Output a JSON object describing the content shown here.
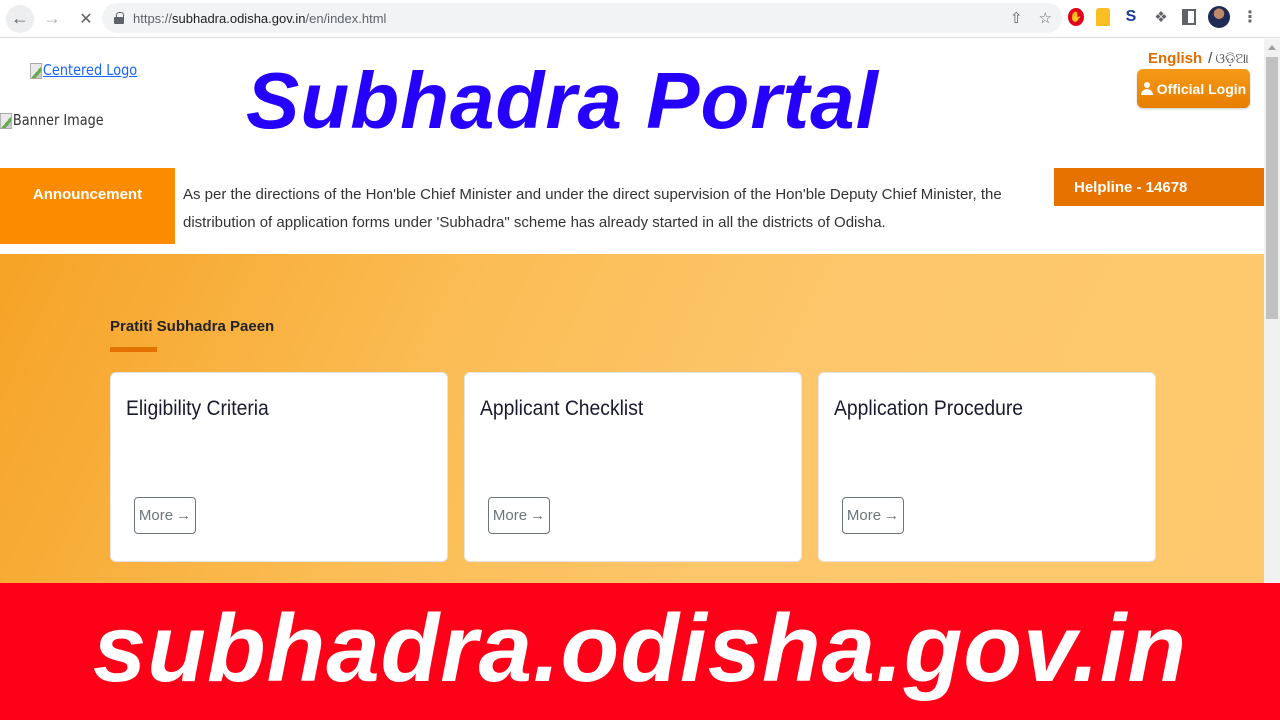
{
  "browser": {
    "url_scheme": "https://",
    "url_host": "subhadra.odisha.gov.in",
    "url_path": "/en/index.html",
    "icons": {
      "back": "back-arrow-icon",
      "forward": "forward-arrow-icon",
      "stop": "stop-loading-icon",
      "lock": "lock-icon",
      "share": "share-icon",
      "bookmark": "star-icon",
      "extensions": [
        "opera-adblock-icon",
        "amber-extension-icon",
        "swirl-extension-icon",
        "puzzle-extensions-icon",
        "side-panel-icon"
      ],
      "profile": "profile-avatar",
      "menu": "kebab-menu-icon"
    }
  },
  "header": {
    "logo_alt": "Centered Logo",
    "banner_alt": "Banner Image",
    "title": "Subhadra Portal",
    "lang_english": "English",
    "lang_separator": "/",
    "lang_odia": "ଓଡ଼ିଆ",
    "login_label": "Official Login"
  },
  "announcement": {
    "label": "Announcement",
    "text": "As per the directions of the Hon'ble Chief Minister and under the direct supervision of the Hon'ble Deputy Chief Minister, the distribution of application forms under 'Subhadra\" scheme has already started in all the districts of Odisha.",
    "helpline": "Helpline - 14678"
  },
  "section": {
    "title": "Pratiti Subhadra Paeen",
    "cards": [
      {
        "title": "Eligibility Criteria",
        "button": "More"
      },
      {
        "title": "Applicant Checklist",
        "button": "More"
      },
      {
        "title": "Application Procedure",
        "button": "More"
      }
    ]
  },
  "overlay_banner": {
    "text": "subhadra.odisha.gov.in"
  },
  "colors": {
    "title_blue": "#2600ff",
    "announcement_orange": "#fb8c00",
    "helpline_orange": "#e67300",
    "banner_red": "#ff0019"
  }
}
